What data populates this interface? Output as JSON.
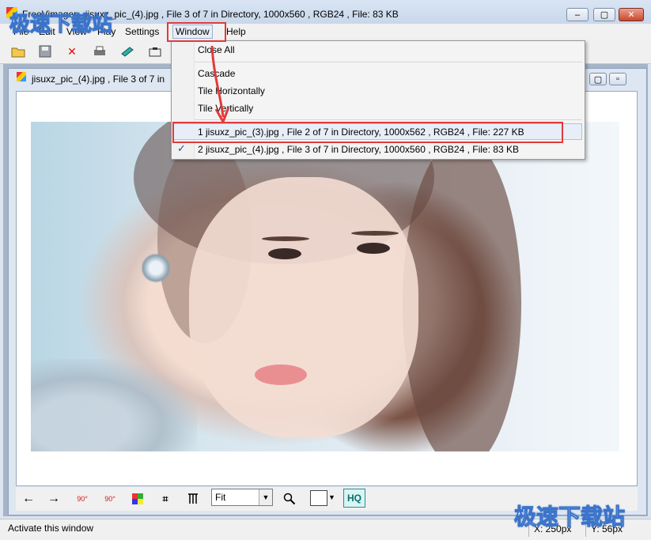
{
  "window": {
    "title": "FreeVimager - jisuxz_pic_(4).jpg , File 3 of 7 in Directory, 1000x560 , RGB24 , File: 83 KB",
    "title_visible": "FreeVimager - jisuxz_pic_(4).jpg , File 3 of 7 in Directory, 1000x560 , RGB24 , File: 83 KB",
    "caption_buttons": {
      "minimize": "–",
      "maximize": "▢",
      "close": "✕"
    }
  },
  "menubar": {
    "items": [
      "File",
      "Edit",
      "View",
      "Play",
      "Settings",
      "Window",
      "Help"
    ]
  },
  "toolbar": {
    "icons": [
      "open-folder-icon",
      "save-icon",
      "delete-icon",
      "print-icon",
      "scan-icon",
      "capture-icon"
    ]
  },
  "child_window": {
    "title": "jisuxz_pic_(4).jpg , File 3 of 7 in Directory, 1000x560 , RGB24 , File: 83 KB",
    "title_visible": "jisuxz_pic_(4).jpg , File 3 of 7 in"
  },
  "window_menu": {
    "close_all": "Close All",
    "cascade": "Cascade",
    "tile_horizontally": "Tile Horizontally",
    "tile_vertically": "Tile Vertically",
    "open_windows": [
      {
        "label": "1 jisuxz_pic_(3).jpg , File 2 of 7 in Directory, 1000x562 , RGB24 , File: 227 KB",
        "checked": false,
        "highlighted": true
      },
      {
        "label": "2 jisuxz_pic_(4).jpg , File 3 of 7 in Directory, 1000x560 , RGB24 , File: 83 KB",
        "checked": true,
        "highlighted": false
      }
    ],
    "check_mark": "✓"
  },
  "bottom_toolbar": {
    "prev": "←",
    "next": "→",
    "rotate_left": "90°",
    "rotate_right": "90°",
    "zoom_value": "Fit",
    "hq_label": "HQ",
    "icons": [
      "prev-arrow-icon",
      "next-arrow-icon",
      "rotate-left-icon",
      "rotate-right-icon",
      "color-palette-icon",
      "crop-icon",
      "levels-icon",
      "zoom-icon",
      "background-color-icon"
    ]
  },
  "statusbar": {
    "text": "Activate this window",
    "x": "X: 250px",
    "y": "Y: 56px"
  },
  "watermark": {
    "text": "极速下载站"
  },
  "colors": {
    "accent_red": "#e23a3a",
    "menu_highlight": "#e7eef7",
    "hq_color": "#0a6e6e"
  }
}
